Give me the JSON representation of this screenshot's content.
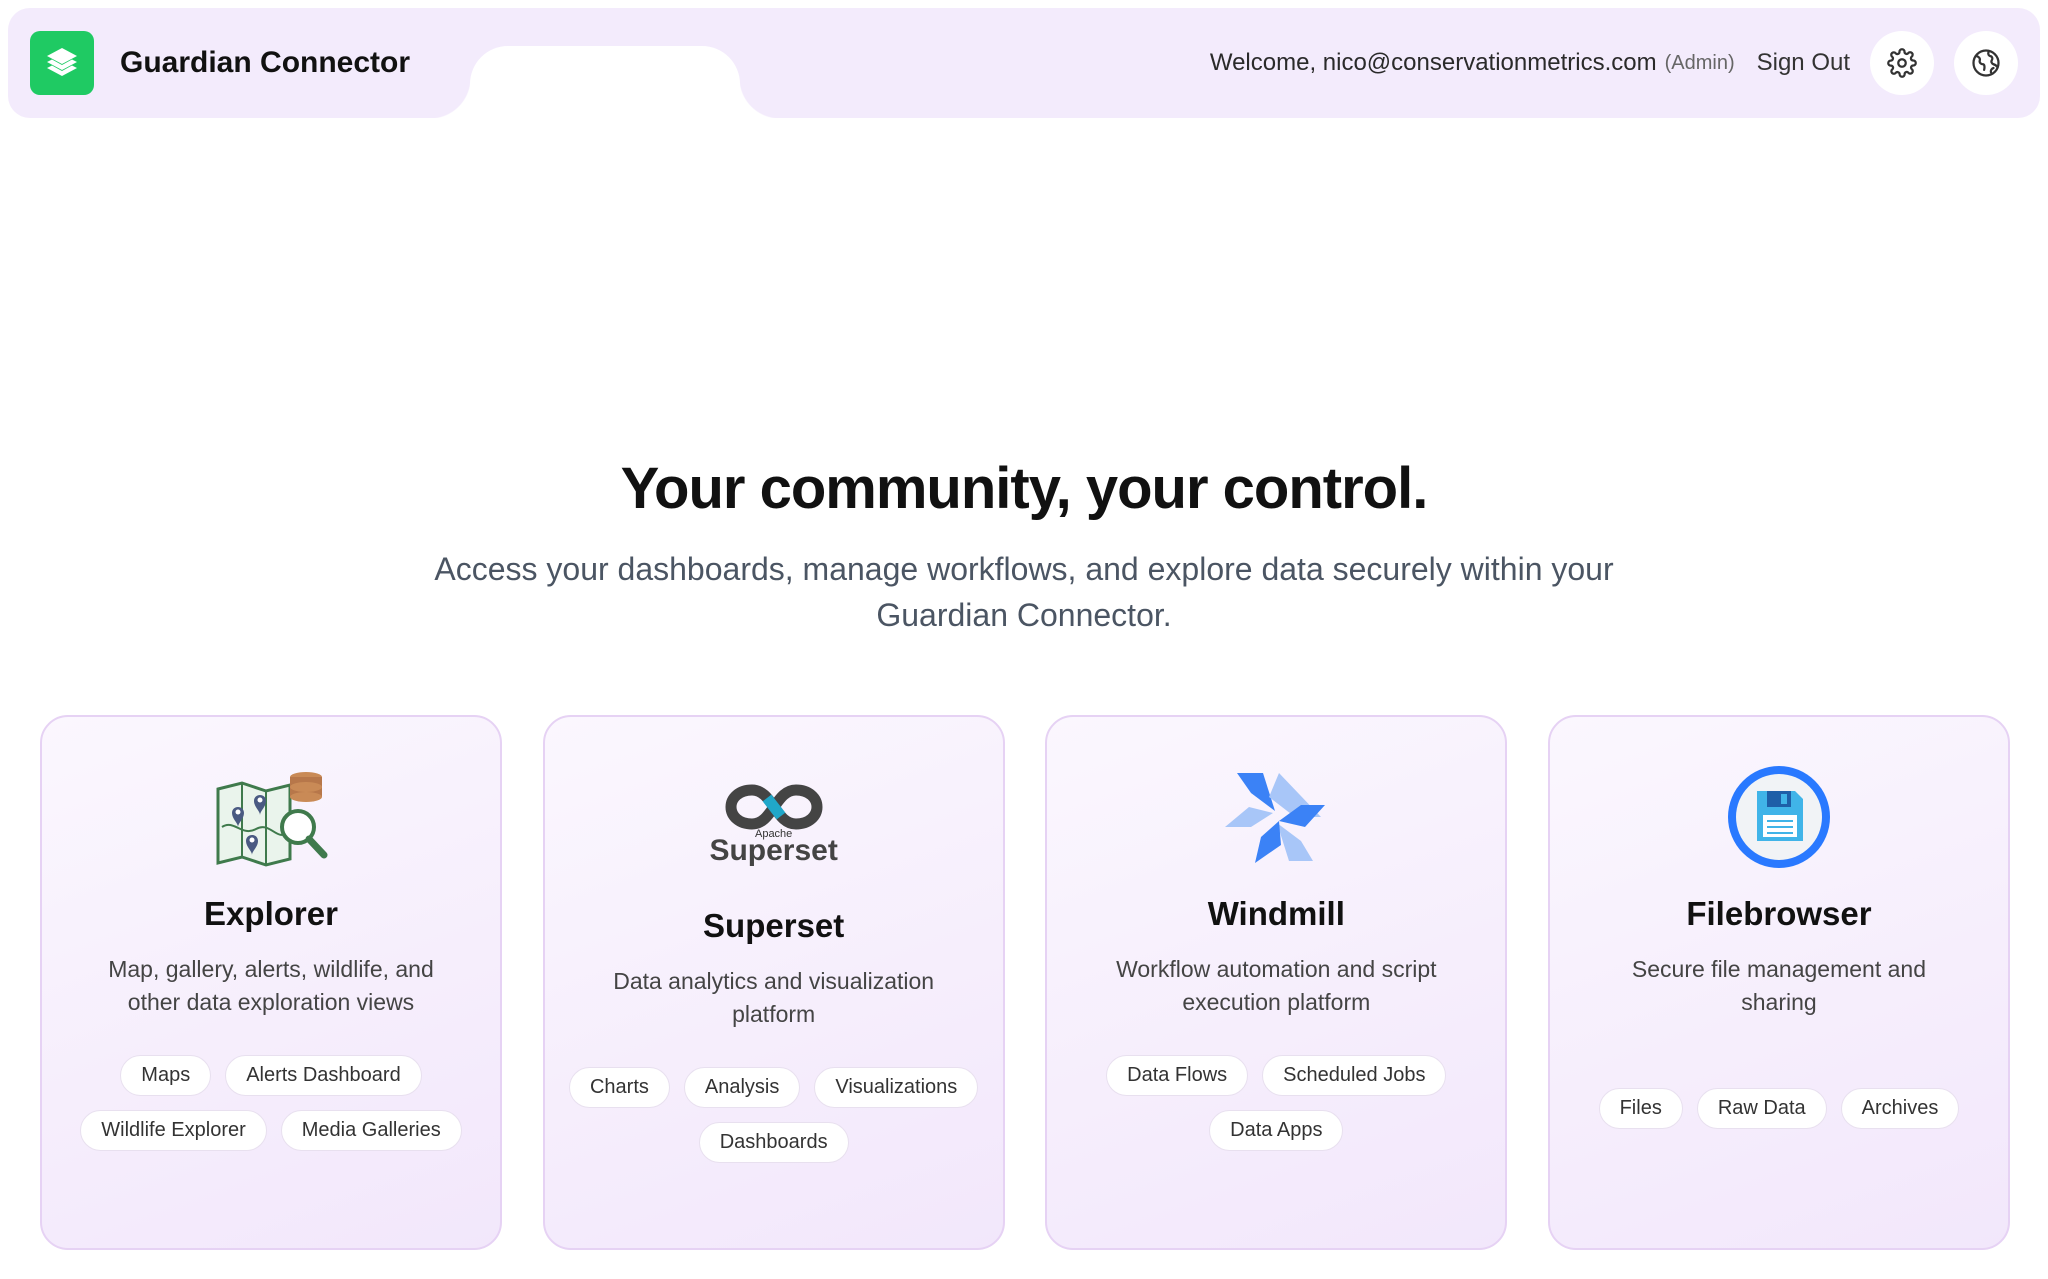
{
  "header": {
    "brand": "Guardian Connector",
    "welcome": "Welcome, nico@conservationmetrics.com",
    "role": "(Admin)",
    "sign_out": "Sign Out",
    "icons": [
      "logo-layers-icon",
      "gear-icon",
      "globe-icon"
    ]
  },
  "hero": {
    "title": "Your community, your control.",
    "subtitle": "Access your dashboards, manage workflows, and explore data securely within your Guardian Connector."
  },
  "cards": [
    {
      "title": "Explorer",
      "description": "Map, gallery, alerts, wildlife, and other data exploration views",
      "tags": [
        "Maps",
        "Alerts Dashboard",
        "Wildlife Explorer",
        "Media Galleries"
      ],
      "icon": "map-search-icon"
    },
    {
      "title": "Superset",
      "description": "Data analytics and visualization platform",
      "logo_text_small": "Apache",
      "logo_text": "Superset",
      "tags": [
        "Charts",
        "Analysis",
        "Visualizations",
        "Dashboards"
      ],
      "icon": "superset-logo-icon"
    },
    {
      "title": "Windmill",
      "description": "Workflow automation and script execution platform",
      "tags": [
        "Data Flows",
        "Scheduled Jobs",
        "Data Apps"
      ],
      "icon": "windmill-logo-icon"
    },
    {
      "title": "Filebrowser",
      "description": "Secure file management and sharing",
      "tags": [
        "Files",
        "Raw Data",
        "Archives"
      ],
      "icon": "floppy-disk-icon"
    }
  ],
  "colors": {
    "brand_green": "#1fca63",
    "header_bg": "#f3ebfc",
    "card_border": "#e6d2f4",
    "superset_teal": "#20a7c9",
    "windmill_blue": "#3b82f6",
    "filebrowser_blue": "#2979ff"
  }
}
